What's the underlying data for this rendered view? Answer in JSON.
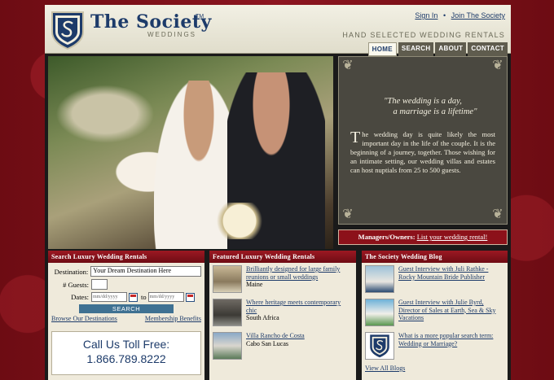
{
  "header": {
    "title": "The Society",
    "title_tm": "TM",
    "subtitle": "WEDDINGS",
    "tagline": "HAND SELECTED WEDDING RENTALS",
    "sign_in": "Sign In",
    "separator": "•",
    "join": "Join The Society"
  },
  "nav": {
    "tabs": [
      {
        "label": "HOME",
        "active": true
      },
      {
        "label": "SEARCH",
        "active": false
      },
      {
        "label": "ABOUT",
        "active": false
      },
      {
        "label": "CONTACT",
        "active": false
      }
    ]
  },
  "quote": {
    "line1": "\"The wedding is a day,",
    "line2": "a marriage is a lifetime\"",
    "dropcap": "T",
    "body": "he wedding day is quite likely the most important day in the life of the couple. It is the beginning of a journey, together. Those wishing for an intimate setting, our wedding villas and estates can host nuptials from 25 to 500 guests."
  },
  "managers": {
    "label": "Managers/Owners:",
    "link": "List your wedding rental!"
  },
  "search_panel": {
    "heading": "Search Luxury Wedding Rentals",
    "destination_label": "Destination:",
    "destination_value": "Your Dream Destination Here",
    "guests_label": "# Guests:",
    "dates_label": "Dates:",
    "date_placeholder": "mm/dd/yyyy",
    "to_label": "to",
    "search_button": "SEARCH",
    "browse_link": "Browse Our Destinations",
    "membership_link": "Membership Benefits",
    "toll_label": "Call Us Toll Free:",
    "toll_number": "1.866.789.8222"
  },
  "featured_panel": {
    "heading": "Featured Luxury Wedding Rentals",
    "items": [
      {
        "title": "Brilliantly designed for large family reunions or small weddings",
        "location": "Maine"
      },
      {
        "title": "Where heritage meets contemporary chic",
        "location": "South Africa"
      },
      {
        "title": "Villa Rancho de Costa",
        "location": "Cabo San Lucas"
      }
    ]
  },
  "blog_panel": {
    "heading": "The Society Wedding Blog",
    "items": [
      {
        "title": "Guest Interview with Juli Rathke - Rocky Mountain Bride Publisher"
      },
      {
        "title": "Guest Interview with Julie Byrd, Director of Sales at Earth, Sea & Sky Vacations"
      },
      {
        "title": "What is a more popular search term: Wedding or Marriage?"
      }
    ],
    "view_all": "View All Blogs"
  },
  "colors": {
    "brand_navy": "#1d3b6a",
    "brand_red": "#8c111a",
    "header_bg": "#f2f0e4",
    "quote_bg": "#4a4840"
  },
  "icons": {
    "logo": "shield-s-logo-icon",
    "calendar": "calendar-icon"
  }
}
